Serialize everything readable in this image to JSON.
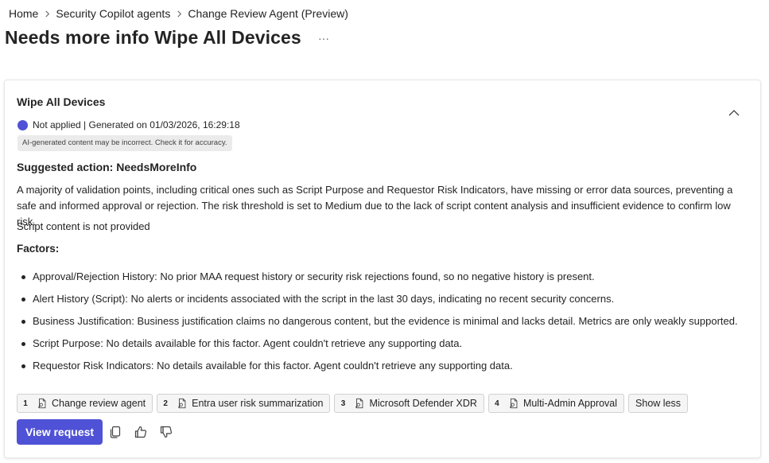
{
  "breadcrumb": {
    "items": [
      "Home",
      "Security Copilot agents",
      "Change Review Agent (Preview)"
    ]
  },
  "page": {
    "title": "Needs more info Wipe All Devices",
    "more_label": "···"
  },
  "card": {
    "title": "Wipe All Devices",
    "status_text": "Not applied | Generated on 01/03/2026, 16:29:18",
    "status_color": "#4f52d6",
    "ai_notice": "AI-generated content may be incorrect. Check it for accuracy.",
    "suggested_action": "Suggested action: NeedsMoreInfo",
    "description": "A majority of validation points, including critical ones such as Script Purpose and Requestor Risk Indicators, have missing or error data sources, preventing a safe and informed approval or rejection. The risk threshold is set to Medium due to the lack of script content analysis and insufficient evidence to confirm low risk.",
    "script_note": "Script content is not provided",
    "factors_title": "Factors:",
    "factors": [
      "Approval/Rejection History: No prior MAA request history or security risk rejections found, so no negative history is present.",
      "Alert History (Script): No alerts or incidents associated with the script in the last 30 days, indicating no recent security concerns.",
      "Business Justification: Business justification claims no dangerous content, but the evidence is minimal and lacks detail. Metrics are only weakly supported.",
      "Script Purpose: No details available for this factor. Agent couldn't retrieve any supporting data.",
      "Requestor Risk Indicators: No details available for this factor. Agent couldn't retrieve any supporting data."
    ],
    "citations": [
      {
        "num": "1",
        "label": "Change review agent",
        "icon": "document-search-icon"
      },
      {
        "num": "2",
        "label": "Entra user risk summarization",
        "icon": "document-search-icon"
      },
      {
        "num": "3",
        "label": "Microsoft Defender XDR",
        "icon": "document-search-icon"
      },
      {
        "num": "4",
        "label": "Multi-Admin Approval",
        "icon": "document-search-icon"
      }
    ],
    "show_less_label": "Show less",
    "view_request_label": "View request",
    "accent_color": "#4f52d6"
  }
}
